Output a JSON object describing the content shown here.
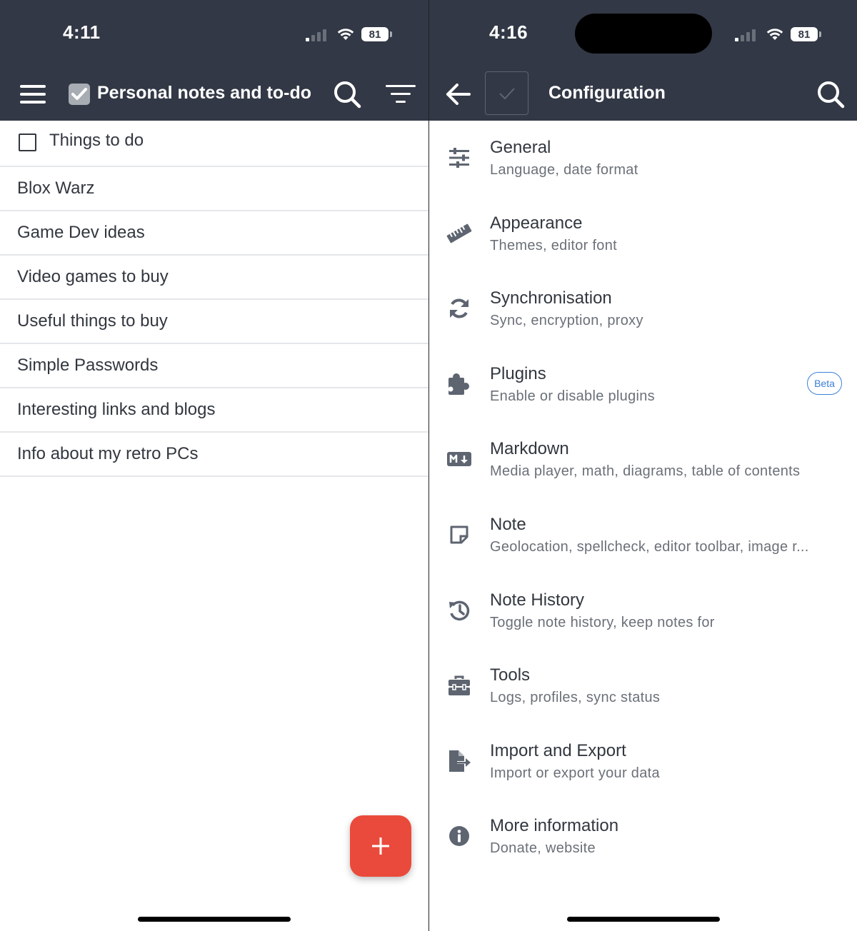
{
  "left": {
    "status": {
      "time": "4:11",
      "battery": "81"
    },
    "toolbar": {
      "menu_icon": "hamburger-menu-icon",
      "title": "Personal notes and to-do",
      "search_icon": "search-icon",
      "sort_icon": "sort-filter-icon"
    },
    "todo": {
      "label": "Things to do",
      "checked": false
    },
    "notes": [
      "Blox Warz",
      "Game Dev ideas",
      "Video games to buy",
      "Useful things to buy",
      "Simple Passwords",
      "Interesting links and blogs",
      "Info about my retro PCs"
    ],
    "fab": {
      "label": "+",
      "color": "#ea4a3b"
    }
  },
  "right": {
    "status": {
      "time": "4:16",
      "battery": "81"
    },
    "toolbar": {
      "back_icon": "back-arrow-icon",
      "title": "Configuration",
      "search_icon": "search-icon"
    },
    "sections": [
      {
        "icon": "sliders-icon",
        "title": "General",
        "subtitle": "Language, date format"
      },
      {
        "icon": "ruler-icon",
        "title": "Appearance",
        "subtitle": "Themes, editor font"
      },
      {
        "icon": "sync-icon",
        "title": "Synchronisation",
        "subtitle": "Sync, encryption, proxy"
      },
      {
        "icon": "puzzle-icon",
        "title": "Plugins",
        "subtitle": "Enable or disable plugins",
        "badge": "Beta"
      },
      {
        "icon": "markdown-icon",
        "title": "Markdown",
        "subtitle": "Media player, math, diagrams, table of contents"
      },
      {
        "icon": "sticky-note-icon",
        "title": "Note",
        "subtitle": "Geolocation, spellcheck, editor toolbar, image r..."
      },
      {
        "icon": "history-icon",
        "title": "Note History",
        "subtitle": "Toggle note history, keep notes for"
      },
      {
        "icon": "toolbox-icon",
        "title": "Tools",
        "subtitle": "Logs, profiles, sync status"
      },
      {
        "icon": "file-export-icon",
        "title": "Import and Export",
        "subtitle": "Import or export your data"
      },
      {
        "icon": "info-icon",
        "title": "More information",
        "subtitle": "Donate, website"
      }
    ]
  },
  "colors": {
    "header": "#323845",
    "text": "#32373f",
    "subtext": "#6b7078",
    "accent_red": "#ea4a3b",
    "beta_blue": "#3a80d8"
  }
}
